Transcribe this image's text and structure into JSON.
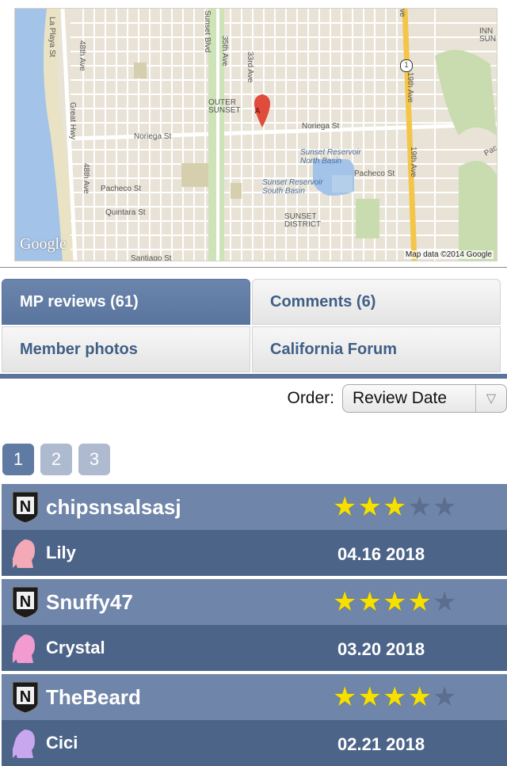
{
  "map": {
    "labels": {
      "la_playa": "La Playa St",
      "great_hwy": "Great Hwy",
      "48th_ave_top": "48th Ave",
      "48th_ave_bottom": "48th Ave",
      "sunset_blvd": "Sunset Blvd",
      "35th_ave": "35th Ave",
      "33rd_ave": "33rd Ave",
      "19th_ave_top": "19th Ave",
      "19th_ave_bottom": "19th Ave",
      "ave_top": "ve",
      "outer_sunset": "OUTER\nSUNSET",
      "noriega_west": "Noriega St",
      "noriega_east": "Noriega St",
      "pacheco_west": "Pacheco St",
      "pacheco_east": "Pacheco St",
      "quintara": "Quintara St",
      "santiago": "Santiago St",
      "reservoir_north": "Sunset Reservoir\nNorth Basin",
      "reservoir_south": "Sunset Reservoir\nSouth Basin",
      "sunset_district": "SUNSET\nDISTRICT",
      "inner_sunset": "INN\nSUN",
      "pac_partial": "Pac",
      "route_shield": "1",
      "marker": "A"
    },
    "google_logo": "Google",
    "copyright": "Map data ©2014 Google"
  },
  "tabs": [
    {
      "label": "MP reviews (61)",
      "active": true
    },
    {
      "label": "Comments (6)",
      "active": false
    },
    {
      "label": "Member photos",
      "active": false
    },
    {
      "label": "California Forum",
      "active": false
    }
  ],
  "order": {
    "label": "Order:",
    "selected": "Review Date"
  },
  "pagination": {
    "pages": [
      "1",
      "2",
      "3"
    ],
    "current": "1"
  },
  "reviews": [
    {
      "username": "chipsnsalsasj",
      "rating": 3,
      "max_rating": 5,
      "reviewer": "Lily",
      "date": "04.16 2018",
      "avatar_color": "#f4a9b6",
      "badge_letter": "N"
    },
    {
      "username": "Snuffy47",
      "rating": 4,
      "max_rating": 5,
      "reviewer": "Crystal",
      "date": "03.20 2018",
      "avatar_color": "#f29bd0",
      "badge_letter": "N"
    },
    {
      "username": "TheBeard",
      "rating": 4,
      "max_rating": 5,
      "reviewer": "Cici",
      "date": "02.21 2018",
      "avatar_color": "#c9a7ee",
      "badge_letter": "N"
    }
  ],
  "colors": {
    "accent": "#5f7aa3",
    "review_top": "#6f85aa",
    "review_bottom": "#4d6489",
    "star_on": "#f6e000"
  }
}
